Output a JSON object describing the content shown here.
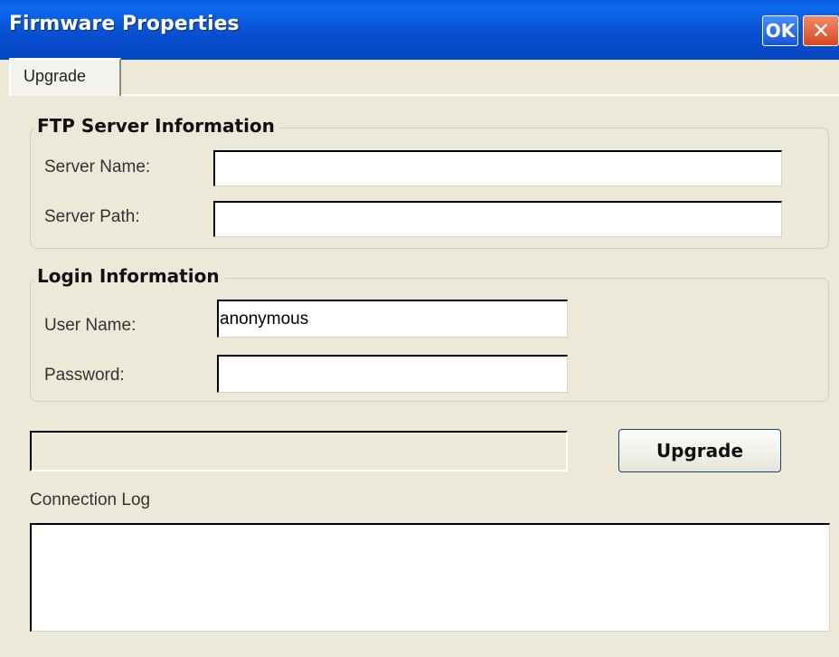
{
  "window": {
    "title": "Firmware Properties",
    "ok_label": "OK",
    "close_glyph": "✕"
  },
  "tabs": [
    {
      "label": "Upgrade",
      "active": true
    }
  ],
  "ftp_group": {
    "title": "FTP Server Information",
    "server_name_label": "Server Name:",
    "server_name_value": "",
    "server_path_label": "Server Path:",
    "server_path_value": ""
  },
  "login_group": {
    "title": "Login Information",
    "user_name_label": "User Name:",
    "user_name_value": "anonymous",
    "password_label": "Password:",
    "password_value": ""
  },
  "progress": {
    "fraction": 0
  },
  "upgrade_button": {
    "label": "Upgrade"
  },
  "log": {
    "label": "Connection Log",
    "content": ""
  },
  "colors": {
    "titlebar": "#0a5ee0",
    "background": "#ece9d8",
    "close_button": "#d9481d"
  },
  "icons": {
    "close": "close-icon"
  }
}
